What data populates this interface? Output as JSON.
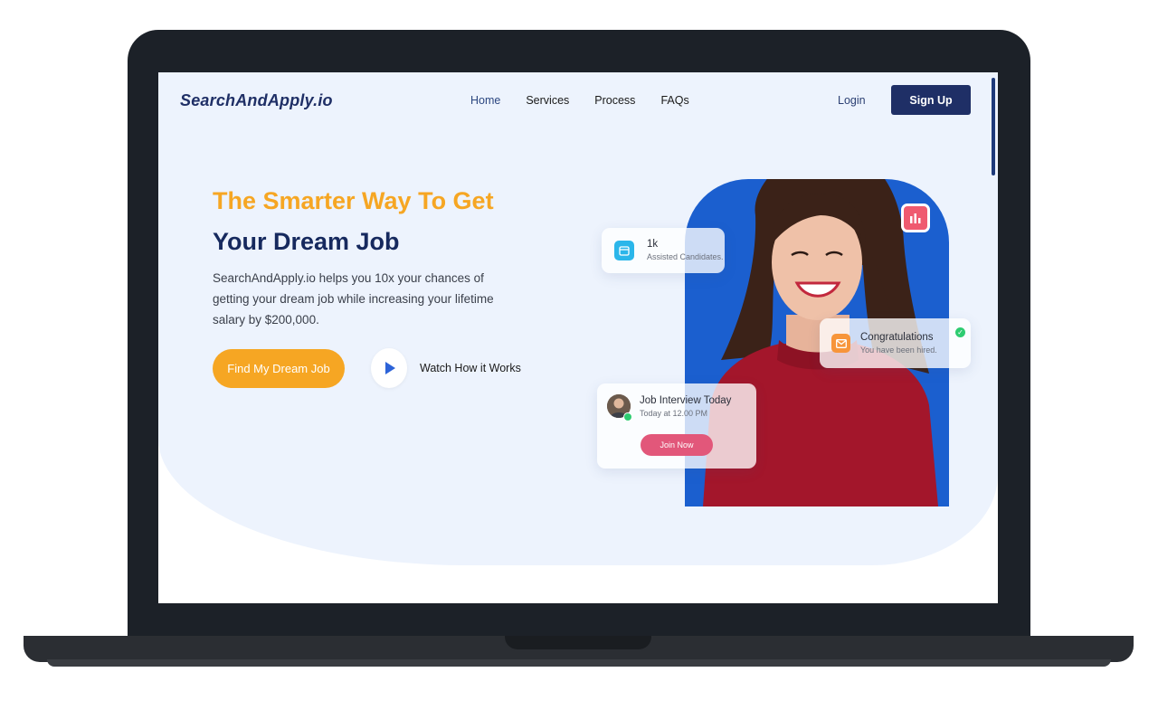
{
  "brand": {
    "logo": "SearchAndApply.io"
  },
  "nav": {
    "items": [
      {
        "label": "Home"
      },
      {
        "label": "Services"
      },
      {
        "label": "Process"
      },
      {
        "label": "FAQs"
      }
    ],
    "login": "Login",
    "signup": "Sign Up"
  },
  "hero": {
    "headline_line1": "The Smarter Way To Get",
    "headline_line2": "Your Dream Job",
    "description": "SearchAndApply.io helps you 10x your chances of getting your dream job while increasing your lifetime salary by $200,000.",
    "cta": "Find My Dream Job",
    "watch": "Watch How it Works"
  },
  "cards": {
    "stat": {
      "value": "1k",
      "label": "Assisted Candidates."
    },
    "congrats": {
      "title": "Congratulations",
      "subtitle": "You have been hired."
    },
    "interview": {
      "title": "Job Interview Today",
      "time": "Today at 12.00 PM",
      "button": "Join Now"
    }
  },
  "colors": {
    "accent_orange": "#f6a623",
    "navy": "#16295e",
    "photo_bg": "#1b5fcf",
    "join_pink": "#e2577a"
  }
}
